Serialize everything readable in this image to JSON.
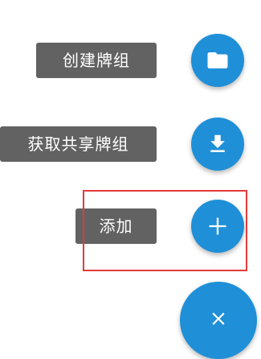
{
  "fab_menu": {
    "items": [
      {
        "label": "创建牌组",
        "icon": "folder-icon"
      },
      {
        "label": "获取共享牌组",
        "icon": "download-icon"
      },
      {
        "label": "添加",
        "icon": "plus-icon"
      }
    ],
    "main_button_icon": "close-icon"
  },
  "colors": {
    "fab": "#1f8fd8",
    "label_background": "#626262",
    "label_text": "#ffffff",
    "highlight_border": "#e23b3b"
  }
}
